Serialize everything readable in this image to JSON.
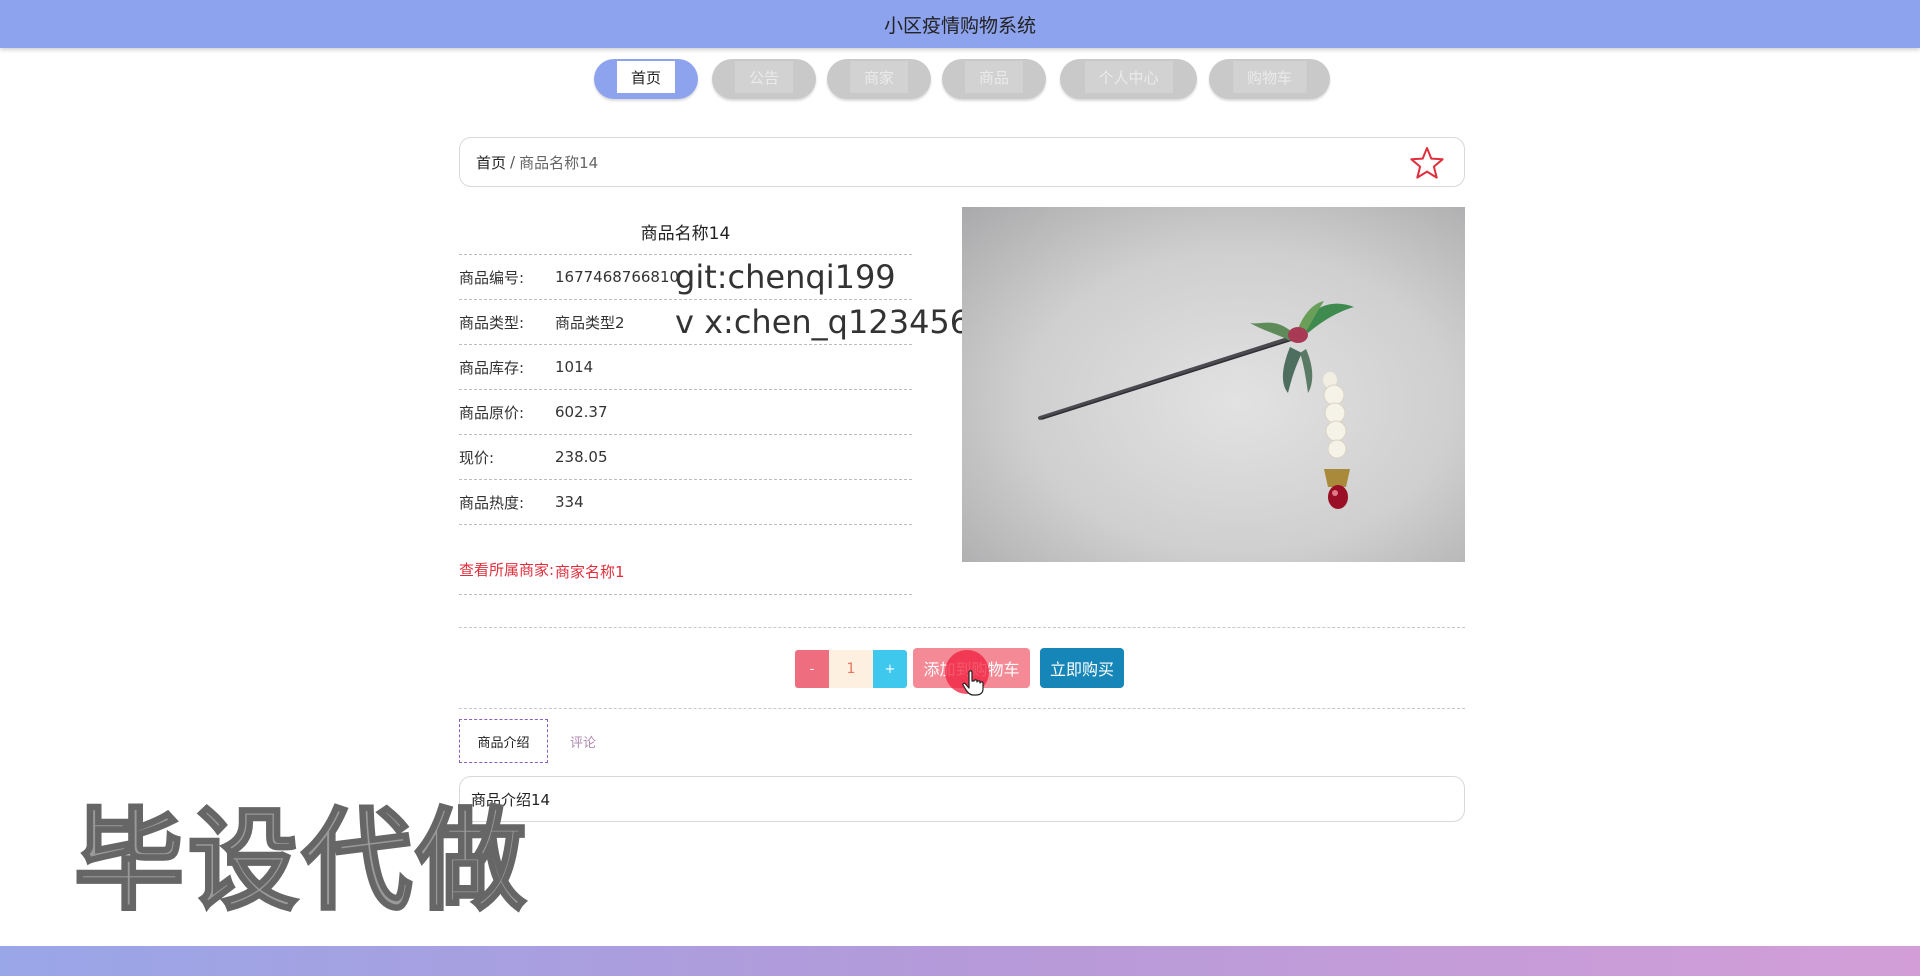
{
  "app": {
    "title": "小区疫情购物系统"
  },
  "nav": {
    "items": [
      {
        "label": "首页",
        "active": true
      },
      {
        "label": "公告",
        "active": false
      },
      {
        "label": "商家",
        "active": false
      },
      {
        "label": "商品",
        "active": false
      },
      {
        "label": "个人中心",
        "active": false
      },
      {
        "label": "购物车",
        "active": false
      }
    ]
  },
  "breadcrumb": {
    "home": "首页",
    "separator": "/",
    "current": "商品名称14"
  },
  "product": {
    "name": "商品名称14",
    "fields": [
      {
        "label": "商品编号:",
        "value": "1677468766810"
      },
      {
        "label": "商品类型:",
        "value": "商品类型2"
      },
      {
        "label": "商品库存:",
        "value": "1014"
      },
      {
        "label": "商品原价:",
        "value": "602.37"
      },
      {
        "label": "现价:",
        "value": "238.05"
      },
      {
        "label": "商品热度:",
        "value": "334"
      }
    ],
    "merchant_link_label": "查看所属商家:",
    "merchant_name": "商家名称1"
  },
  "watermarks": {
    "git": "git:chenqi199",
    "vx": "v x:chen_q123456",
    "big": "毕设代做"
  },
  "purchase": {
    "minus_label": "-",
    "quantity": "1",
    "plus_label": "+",
    "add_to_cart_label": "添加到购物车",
    "buy_now_label": "立即购买"
  },
  "tabs": [
    {
      "label": "商品介绍",
      "active": true
    },
    {
      "label": "评论",
      "active": false
    }
  ],
  "description": "商品介绍14",
  "colors": {
    "header": "#8ea3ee",
    "accent_red": "#e02f3c",
    "buy_blue": "#1686b8",
    "cart_pink": "#f38a96"
  },
  "icons": {
    "favorite": "star-icon",
    "cursor": "hand-pointer-icon"
  }
}
